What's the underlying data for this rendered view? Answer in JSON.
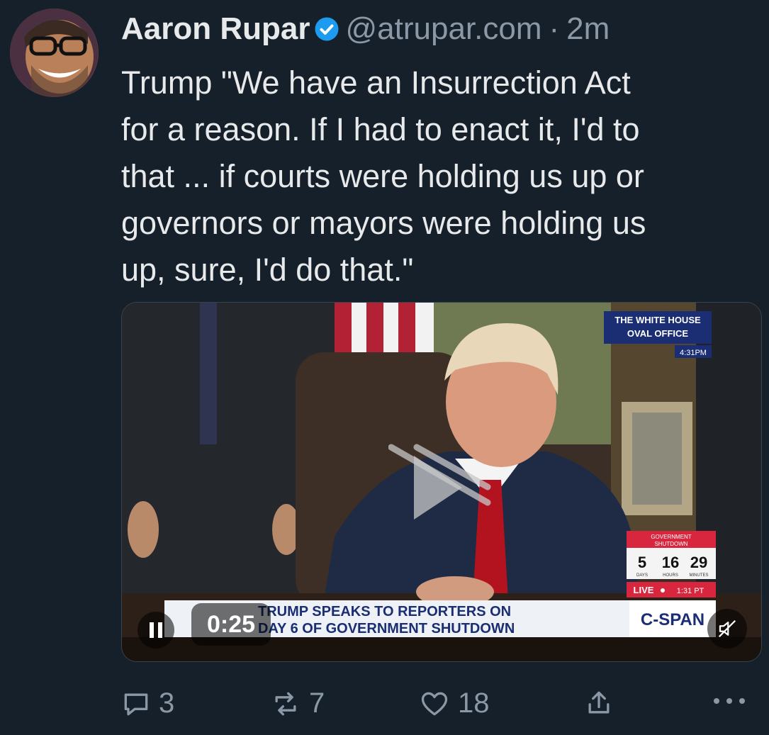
{
  "author": {
    "name": "Aaron Rupar",
    "handle": "@atrupar.com",
    "separator": "·",
    "time": "2m",
    "verified": true
  },
  "tweet": {
    "text": "Trump \"We have an Insurrection Act\nfor a reason. If I had to enact it, I'd to\nthat ... if courts were holding us up or\ngovernors or mayors were holding us\nup, sure, I'd do that.\""
  },
  "video": {
    "timestamp": "0:25",
    "overlay": {
      "location_line1": "THE WHITE HOUSE",
      "location_line2": "OVAL OFFICE",
      "clock": "4:31PM",
      "shutdown_title": "GOVERNMENT",
      "shutdown_sub": "SHUTDOWN",
      "days": "5",
      "hours": "16",
      "minutes": "29",
      "days_label": "DAYS",
      "hours_label": "HOURS",
      "minutes_label": "MINUTES",
      "live": "LIVE",
      "live_time": "1:31 PT",
      "headline1": "TRUMP SPEAKS TO REPORTERS ON",
      "headline2": "DAY 6 OF GOVERNMENT SHUTDOWN",
      "network": "C-SPAN"
    }
  },
  "actions": {
    "replies": "3",
    "reposts": "7",
    "likes": "18"
  },
  "colors": {
    "background": "#15202b",
    "text": "#e7e9ea",
    "muted": "#8b98a5",
    "verified": "#1d9bf0",
    "cspan_red": "#d7263d"
  }
}
